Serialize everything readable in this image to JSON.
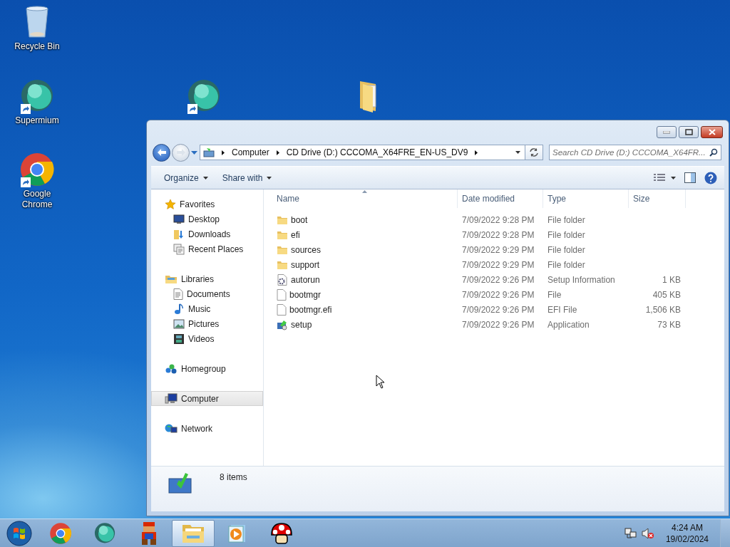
{
  "desktop": {
    "icons": [
      {
        "kind": "recycle-bin",
        "label": "Recycle Bin",
        "shortcut": false
      },
      {
        "kind": "supermium",
        "label": "Supermium",
        "shortcut": true
      },
      {
        "kind": "chrome",
        "label": "Google Chrome",
        "shortcut": true
      },
      {
        "kind": "supermium",
        "shortcut": true
      },
      {
        "kind": "folder",
        "shortcut": false
      }
    ]
  },
  "window": {
    "address": {
      "segments": [
        "Computer",
        "CD Drive (D:) CCCOMA_X64FRE_EN-US_DV9"
      ]
    },
    "search": {
      "placeholder": "Search CD Drive (D:) CCCOMA_X64FR..."
    },
    "toolbar": {
      "buttons": [
        "Organize",
        "Share with"
      ]
    },
    "sidebar": {
      "groups": [
        {
          "label": "Favorites",
          "kind": "star",
          "selected": false,
          "children": [
            {
              "label": "Desktop",
              "kind": "desktop",
              "selected": false
            },
            {
              "label": "Downloads",
              "kind": "downloads",
              "selected": false
            },
            {
              "label": "Recent Places",
              "kind": "recent",
              "selected": false
            }
          ]
        },
        {
          "label": "Libraries",
          "kind": "libraries",
          "selected": false,
          "children": [
            {
              "label": "Documents",
              "kind": "documents",
              "selected": false
            },
            {
              "label": "Music",
              "kind": "music",
              "selected": false
            },
            {
              "label": "Pictures",
              "kind": "pictures",
              "selected": false
            },
            {
              "label": "Videos",
              "kind": "videos",
              "selected": false
            }
          ]
        },
        {
          "label": "Homegroup",
          "kind": "homegroup",
          "selected": false
        },
        {
          "label": "Computer",
          "kind": "computer",
          "selected": true
        },
        {
          "label": "Network",
          "kind": "network",
          "selected": false
        }
      ]
    },
    "columns": [
      "Name",
      "Date modified",
      "Type",
      "Size"
    ],
    "files": [
      {
        "kind": "folder",
        "name": "boot",
        "date": "7/09/2022 9:28 PM",
        "type": "File folder"
      },
      {
        "kind": "folder",
        "name": "efi",
        "date": "7/09/2022 9:28 PM",
        "type": "File folder"
      },
      {
        "kind": "folder",
        "name": "sources",
        "date": "7/09/2022 9:29 PM",
        "type": "File folder"
      },
      {
        "kind": "folder",
        "name": "support",
        "date": "7/09/2022 9:29 PM",
        "type": "File folder"
      },
      {
        "kind": "settings",
        "name": "autorun",
        "date": "7/09/2022 9:26 PM",
        "type": "Setup Information",
        "size": "1 KB"
      },
      {
        "kind": "file",
        "name": "bootmgr",
        "date": "7/09/2022 9:26 PM",
        "type": "File",
        "size": "405 KB"
      },
      {
        "kind": "file",
        "name": "bootmgr.efi",
        "date": "7/09/2022 9:26 PM",
        "type": "EFI File",
        "size": "1,506 KB"
      },
      {
        "kind": "app",
        "name": "setup",
        "date": "7/09/2022 9:26 PM",
        "type": "Application",
        "size": "73 KB"
      }
    ],
    "details": {
      "summary": "8 items"
    }
  },
  "taskbar": {
    "apps": [
      {
        "kind": "chrome",
        "selected": false
      },
      {
        "kind": "supermium",
        "selected": false
      },
      {
        "kind": "figure",
        "selected": false
      },
      {
        "kind": "explorer",
        "selected": true
      },
      {
        "kind": "media",
        "selected": false
      },
      {
        "kind": "mushroom",
        "selected": false
      }
    ],
    "clock": {
      "time": "4:24 AM",
      "date": "19/02/2024"
    }
  }
}
